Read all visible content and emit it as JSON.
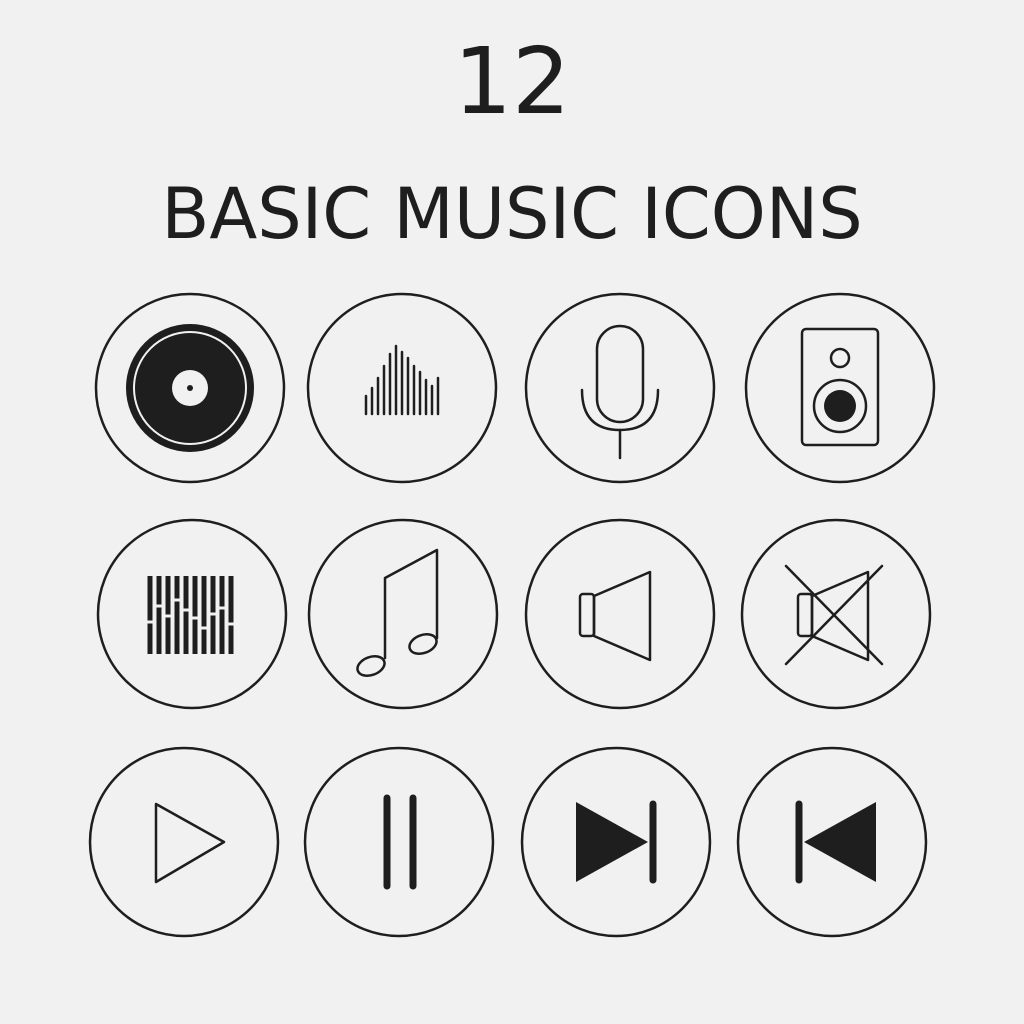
{
  "header": {
    "number": "12",
    "title": "BASIC MUSIC ICONS"
  },
  "colors": {
    "background": "#f1f1f1",
    "ink": "#1e1e1e"
  },
  "icons": [
    "vinyl-record-icon",
    "sound-wave-icon",
    "microphone-icon",
    "speaker-box-icon",
    "equalizer-icon",
    "music-note-icon",
    "volume-icon",
    "mute-icon",
    "play-icon",
    "pause-icon",
    "next-track-icon",
    "previous-track-icon"
  ]
}
